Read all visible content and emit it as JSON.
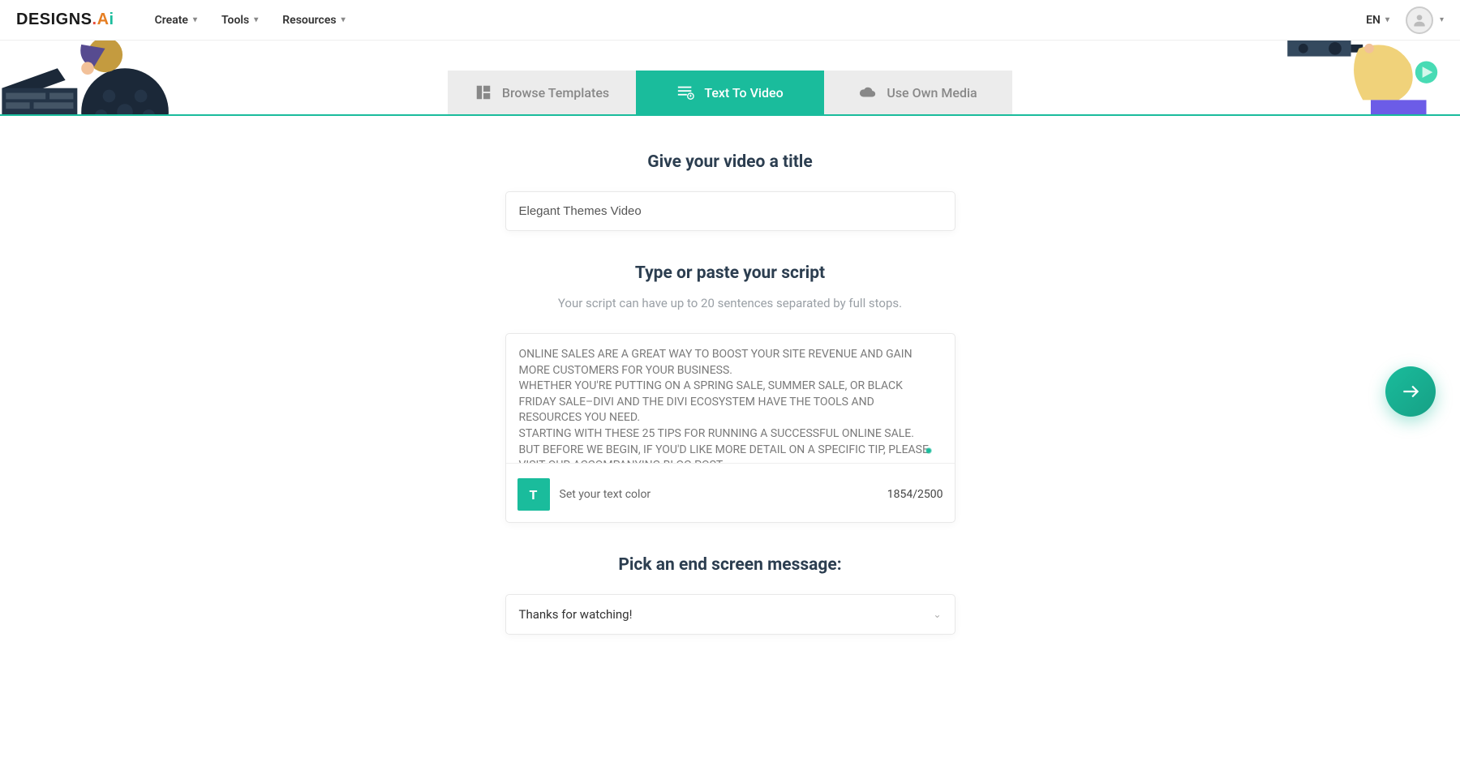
{
  "header": {
    "logo_text": "DESIGNS",
    "nav": {
      "create": "Create",
      "tools": "Tools",
      "resources": "Resources"
    },
    "lang": "EN"
  },
  "tabs": {
    "browse": "Browse Templates",
    "text_to_video": "Text To Video",
    "own_media": "Use Own Media"
  },
  "title_section": {
    "heading": "Give your video a title",
    "value": "Elegant Themes Video"
  },
  "script_section": {
    "heading": "Type or paste your script",
    "hint": "Your script can have up to 20 sentences separated by full stops.",
    "value": "ONLINE SALES ARE A GREAT WAY TO BOOST YOUR SITE REVENUE AND GAIN MORE CUSTOMERS FOR YOUR BUSINESS.\nWHETHER YOU'RE PUTTING ON A SPRING SALE, SUMMER SALE, OR BLACK FRIDAY SALE–DIVI AND THE DIVI ECOSYSTEM HAVE THE TOOLS AND RESOURCES YOU NEED.\nSTARTING WITH THESE 25 TIPS FOR RUNNING A SUCCESSFUL ONLINE SALE.\nBUT BEFORE WE BEGIN, IF YOU'D LIKE MORE DETAIL ON A SPECIFIC TIP, PLEASE VISIT OUR ACCOMPANYING BLOG POST.",
    "color_chip": "T",
    "color_label": "Set your text color",
    "char_count": "1854/2500"
  },
  "end_section": {
    "heading": "Pick an end screen message:",
    "selected": "Thanks for watching!"
  }
}
